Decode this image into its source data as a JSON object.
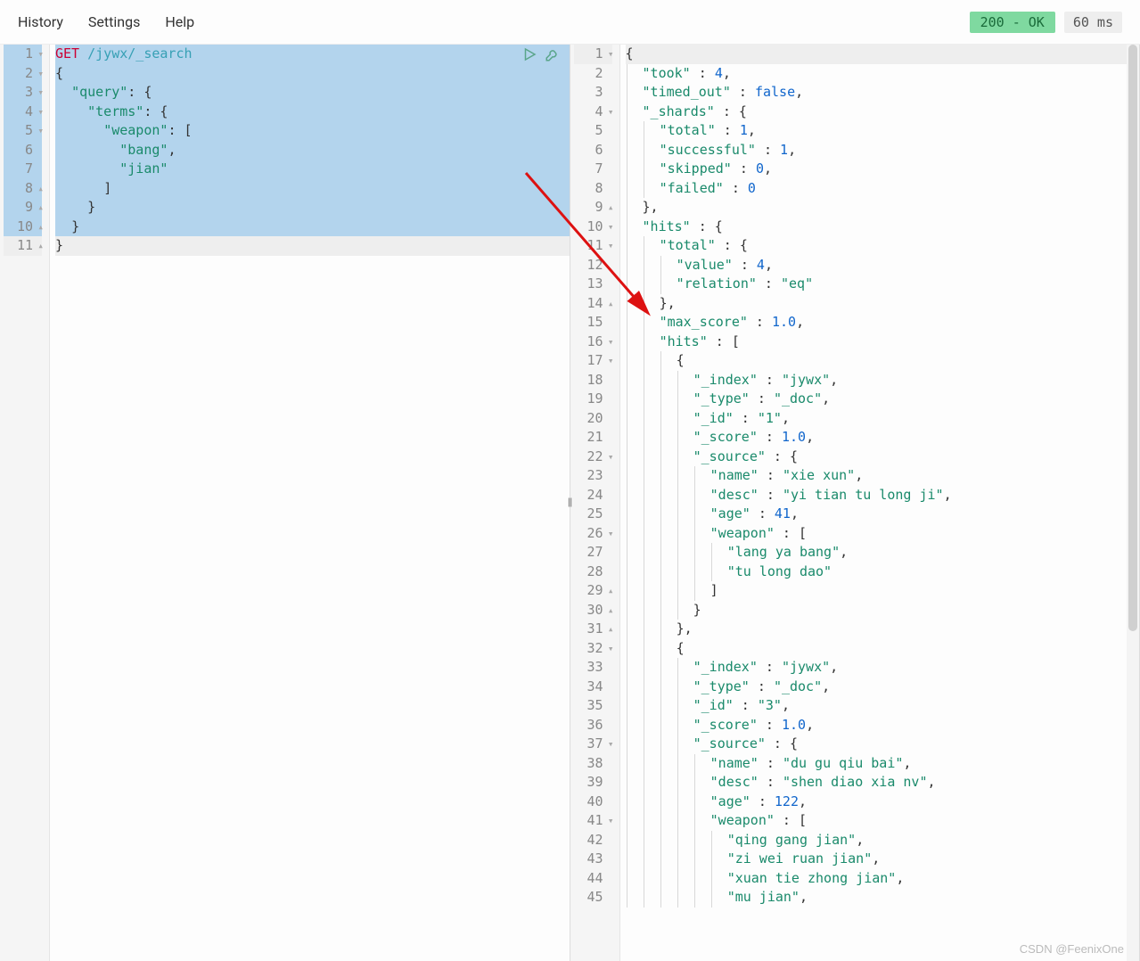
{
  "menubar": {
    "history": "History",
    "settings": "Settings",
    "help": "Help"
  },
  "status": {
    "code_text": "200 - OK",
    "timing": "60 ms"
  },
  "request": {
    "lines": [
      {
        "n": 1,
        "fold": "▾",
        "sel": true,
        "cur": true,
        "parts": [
          {
            "t": "method",
            "v": "GET"
          },
          {
            "t": "plain",
            "v": " "
          },
          {
            "t": "path",
            "v": "/jywx/_search"
          }
        ]
      },
      {
        "n": 2,
        "fold": "▾",
        "sel": true,
        "parts": [
          {
            "t": "punc",
            "v": "{"
          }
        ]
      },
      {
        "n": 3,
        "fold": "▾",
        "sel": true,
        "indent": 1,
        "parts": [
          {
            "t": "key",
            "v": "\"query\""
          },
          {
            "t": "punc",
            "v": ": {"
          }
        ]
      },
      {
        "n": 4,
        "fold": "▾",
        "sel": true,
        "indent": 2,
        "parts": [
          {
            "t": "key",
            "v": "\"terms\""
          },
          {
            "t": "punc",
            "v": ": {"
          }
        ]
      },
      {
        "n": 5,
        "fold": "▾",
        "sel": true,
        "indent": 3,
        "parts": [
          {
            "t": "key",
            "v": "\"weapon\""
          },
          {
            "t": "punc",
            "v": ": ["
          }
        ]
      },
      {
        "n": 6,
        "sel": true,
        "indent": 4,
        "parts": [
          {
            "t": "str",
            "v": "\"bang\""
          },
          {
            "t": "punc",
            "v": ","
          }
        ]
      },
      {
        "n": 7,
        "sel": true,
        "indent": 4,
        "parts": [
          {
            "t": "str",
            "v": "\"jian\""
          }
        ]
      },
      {
        "n": 8,
        "fold": "▴",
        "sel": true,
        "indent": 3,
        "parts": [
          {
            "t": "punc",
            "v": "]"
          }
        ]
      },
      {
        "n": 9,
        "fold": "▴",
        "sel": true,
        "indent": 2,
        "parts": [
          {
            "t": "punc",
            "v": "}"
          }
        ]
      },
      {
        "n": 10,
        "fold": "▴",
        "sel": true,
        "indent": 1,
        "parts": [
          {
            "t": "punc",
            "v": "}"
          }
        ]
      },
      {
        "n": 11,
        "fold": "▴",
        "cur": true,
        "parts": [
          {
            "t": "punc",
            "v": "}"
          }
        ]
      }
    ]
  },
  "response": {
    "lines": [
      {
        "n": 1,
        "fold": "▾",
        "cur": true,
        "parts": [
          {
            "t": "punc",
            "v": "{"
          }
        ]
      },
      {
        "n": 2,
        "indent": 1,
        "parts": [
          {
            "t": "key",
            "v": "\"took\""
          },
          {
            "t": "punc",
            "v": " : "
          },
          {
            "t": "num",
            "v": "4"
          },
          {
            "t": "punc",
            "v": ","
          }
        ]
      },
      {
        "n": 3,
        "indent": 1,
        "parts": [
          {
            "t": "key",
            "v": "\"timed_out\""
          },
          {
            "t": "punc",
            "v": " : "
          },
          {
            "t": "bool",
            "v": "false"
          },
          {
            "t": "punc",
            "v": ","
          }
        ]
      },
      {
        "n": 4,
        "fold": "▾",
        "indent": 1,
        "parts": [
          {
            "t": "key",
            "v": "\"_shards\""
          },
          {
            "t": "punc",
            "v": " : {"
          }
        ]
      },
      {
        "n": 5,
        "indent": 2,
        "parts": [
          {
            "t": "key",
            "v": "\"total\""
          },
          {
            "t": "punc",
            "v": " : "
          },
          {
            "t": "num",
            "v": "1"
          },
          {
            "t": "punc",
            "v": ","
          }
        ]
      },
      {
        "n": 6,
        "indent": 2,
        "parts": [
          {
            "t": "key",
            "v": "\"successful\""
          },
          {
            "t": "punc",
            "v": " : "
          },
          {
            "t": "num",
            "v": "1"
          },
          {
            "t": "punc",
            "v": ","
          }
        ]
      },
      {
        "n": 7,
        "indent": 2,
        "parts": [
          {
            "t": "key",
            "v": "\"skipped\""
          },
          {
            "t": "punc",
            "v": " : "
          },
          {
            "t": "num",
            "v": "0"
          },
          {
            "t": "punc",
            "v": ","
          }
        ]
      },
      {
        "n": 8,
        "indent": 2,
        "parts": [
          {
            "t": "key",
            "v": "\"failed\""
          },
          {
            "t": "punc",
            "v": " : "
          },
          {
            "t": "num",
            "v": "0"
          }
        ]
      },
      {
        "n": 9,
        "fold": "▴",
        "indent": 1,
        "parts": [
          {
            "t": "punc",
            "v": "},"
          }
        ]
      },
      {
        "n": 10,
        "fold": "▾",
        "indent": 1,
        "parts": [
          {
            "t": "key",
            "v": "\"hits\""
          },
          {
            "t": "punc",
            "v": " : {"
          }
        ]
      },
      {
        "n": 11,
        "fold": "▾",
        "indent": 2,
        "parts": [
          {
            "t": "key",
            "v": "\"total\""
          },
          {
            "t": "punc",
            "v": " : {"
          }
        ]
      },
      {
        "n": 12,
        "indent": 3,
        "parts": [
          {
            "t": "key",
            "v": "\"value\""
          },
          {
            "t": "punc",
            "v": " : "
          },
          {
            "t": "num",
            "v": "4"
          },
          {
            "t": "punc",
            "v": ","
          }
        ]
      },
      {
        "n": 13,
        "indent": 3,
        "parts": [
          {
            "t": "key",
            "v": "\"relation\""
          },
          {
            "t": "punc",
            "v": " : "
          },
          {
            "t": "str",
            "v": "\"eq\""
          }
        ]
      },
      {
        "n": 14,
        "fold": "▴",
        "indent": 2,
        "parts": [
          {
            "t": "punc",
            "v": "},"
          }
        ]
      },
      {
        "n": 15,
        "indent": 2,
        "parts": [
          {
            "t": "key",
            "v": "\"max_score\""
          },
          {
            "t": "punc",
            "v": " : "
          },
          {
            "t": "num",
            "v": "1.0"
          },
          {
            "t": "punc",
            "v": ","
          }
        ]
      },
      {
        "n": 16,
        "fold": "▾",
        "indent": 2,
        "parts": [
          {
            "t": "key",
            "v": "\"hits\""
          },
          {
            "t": "punc",
            "v": " : ["
          }
        ]
      },
      {
        "n": 17,
        "fold": "▾",
        "indent": 3,
        "parts": [
          {
            "t": "punc",
            "v": "{"
          }
        ]
      },
      {
        "n": 18,
        "indent": 4,
        "parts": [
          {
            "t": "key",
            "v": "\"_index\""
          },
          {
            "t": "punc",
            "v": " : "
          },
          {
            "t": "str",
            "v": "\"jywx\""
          },
          {
            "t": "punc",
            "v": ","
          }
        ]
      },
      {
        "n": 19,
        "indent": 4,
        "parts": [
          {
            "t": "key",
            "v": "\"_type\""
          },
          {
            "t": "punc",
            "v": " : "
          },
          {
            "t": "str",
            "v": "\"_doc\""
          },
          {
            "t": "punc",
            "v": ","
          }
        ]
      },
      {
        "n": 20,
        "indent": 4,
        "parts": [
          {
            "t": "key",
            "v": "\"_id\""
          },
          {
            "t": "punc",
            "v": " : "
          },
          {
            "t": "str",
            "v": "\"1\""
          },
          {
            "t": "punc",
            "v": ","
          }
        ]
      },
      {
        "n": 21,
        "indent": 4,
        "parts": [
          {
            "t": "key",
            "v": "\"_score\""
          },
          {
            "t": "punc",
            "v": " : "
          },
          {
            "t": "num",
            "v": "1.0"
          },
          {
            "t": "punc",
            "v": ","
          }
        ]
      },
      {
        "n": 22,
        "fold": "▾",
        "indent": 4,
        "parts": [
          {
            "t": "key",
            "v": "\"_source\""
          },
          {
            "t": "punc",
            "v": " : {"
          }
        ]
      },
      {
        "n": 23,
        "indent": 5,
        "parts": [
          {
            "t": "key",
            "v": "\"name\""
          },
          {
            "t": "punc",
            "v": " : "
          },
          {
            "t": "str",
            "v": "\"xie xun\""
          },
          {
            "t": "punc",
            "v": ","
          }
        ]
      },
      {
        "n": 24,
        "indent": 5,
        "parts": [
          {
            "t": "key",
            "v": "\"desc\""
          },
          {
            "t": "punc",
            "v": " : "
          },
          {
            "t": "str",
            "v": "\"yi tian tu long ji\""
          },
          {
            "t": "punc",
            "v": ","
          }
        ]
      },
      {
        "n": 25,
        "indent": 5,
        "parts": [
          {
            "t": "key",
            "v": "\"age\""
          },
          {
            "t": "punc",
            "v": " : "
          },
          {
            "t": "num",
            "v": "41"
          },
          {
            "t": "punc",
            "v": ","
          }
        ]
      },
      {
        "n": 26,
        "fold": "▾",
        "indent": 5,
        "parts": [
          {
            "t": "key",
            "v": "\"weapon\""
          },
          {
            "t": "punc",
            "v": " : ["
          }
        ]
      },
      {
        "n": 27,
        "indent": 6,
        "parts": [
          {
            "t": "str",
            "v": "\"lang ya bang\""
          },
          {
            "t": "punc",
            "v": ","
          }
        ]
      },
      {
        "n": 28,
        "indent": 6,
        "parts": [
          {
            "t": "str",
            "v": "\"tu long dao\""
          }
        ]
      },
      {
        "n": 29,
        "fold": "▴",
        "indent": 5,
        "parts": [
          {
            "t": "punc",
            "v": "]"
          }
        ]
      },
      {
        "n": 30,
        "fold": "▴",
        "indent": 4,
        "parts": [
          {
            "t": "punc",
            "v": "}"
          }
        ]
      },
      {
        "n": 31,
        "fold": "▴",
        "indent": 3,
        "parts": [
          {
            "t": "punc",
            "v": "},"
          }
        ]
      },
      {
        "n": 32,
        "fold": "▾",
        "indent": 3,
        "parts": [
          {
            "t": "punc",
            "v": "{"
          }
        ]
      },
      {
        "n": 33,
        "indent": 4,
        "parts": [
          {
            "t": "key",
            "v": "\"_index\""
          },
          {
            "t": "punc",
            "v": " : "
          },
          {
            "t": "str",
            "v": "\"jywx\""
          },
          {
            "t": "punc",
            "v": ","
          }
        ]
      },
      {
        "n": 34,
        "indent": 4,
        "parts": [
          {
            "t": "key",
            "v": "\"_type\""
          },
          {
            "t": "punc",
            "v": " : "
          },
          {
            "t": "str",
            "v": "\"_doc\""
          },
          {
            "t": "punc",
            "v": ","
          }
        ]
      },
      {
        "n": 35,
        "indent": 4,
        "parts": [
          {
            "t": "key",
            "v": "\"_id\""
          },
          {
            "t": "punc",
            "v": " : "
          },
          {
            "t": "str",
            "v": "\"3\""
          },
          {
            "t": "punc",
            "v": ","
          }
        ]
      },
      {
        "n": 36,
        "indent": 4,
        "parts": [
          {
            "t": "key",
            "v": "\"_score\""
          },
          {
            "t": "punc",
            "v": " : "
          },
          {
            "t": "num",
            "v": "1.0"
          },
          {
            "t": "punc",
            "v": ","
          }
        ]
      },
      {
        "n": 37,
        "fold": "▾",
        "indent": 4,
        "parts": [
          {
            "t": "key",
            "v": "\"_source\""
          },
          {
            "t": "punc",
            "v": " : {"
          }
        ]
      },
      {
        "n": 38,
        "indent": 5,
        "parts": [
          {
            "t": "key",
            "v": "\"name\""
          },
          {
            "t": "punc",
            "v": " : "
          },
          {
            "t": "str",
            "v": "\"du gu qiu bai\""
          },
          {
            "t": "punc",
            "v": ","
          }
        ]
      },
      {
        "n": 39,
        "indent": 5,
        "parts": [
          {
            "t": "key",
            "v": "\"desc\""
          },
          {
            "t": "punc",
            "v": " : "
          },
          {
            "t": "str",
            "v": "\"shen diao xia nv\""
          },
          {
            "t": "punc",
            "v": ","
          }
        ]
      },
      {
        "n": 40,
        "indent": 5,
        "parts": [
          {
            "t": "key",
            "v": "\"age\""
          },
          {
            "t": "punc",
            "v": " : "
          },
          {
            "t": "num",
            "v": "122"
          },
          {
            "t": "punc",
            "v": ","
          }
        ]
      },
      {
        "n": 41,
        "fold": "▾",
        "indent": 5,
        "parts": [
          {
            "t": "key",
            "v": "\"weapon\""
          },
          {
            "t": "punc",
            "v": " : ["
          }
        ]
      },
      {
        "n": 42,
        "indent": 6,
        "parts": [
          {
            "t": "str",
            "v": "\"qing gang jian\""
          },
          {
            "t": "punc",
            "v": ","
          }
        ]
      },
      {
        "n": 43,
        "indent": 6,
        "parts": [
          {
            "t": "str",
            "v": "\"zi wei ruan jian\""
          },
          {
            "t": "punc",
            "v": ","
          }
        ]
      },
      {
        "n": 44,
        "indent": 6,
        "parts": [
          {
            "t": "str",
            "v": "\"xuan tie zhong jian\""
          },
          {
            "t": "punc",
            "v": ","
          }
        ]
      },
      {
        "n": 45,
        "indent": 6,
        "parts": [
          {
            "t": "str",
            "v": "\"mu jian\""
          },
          {
            "t": "punc",
            "v": ","
          }
        ]
      }
    ]
  },
  "watermark": "CSDN @FeenixOne"
}
